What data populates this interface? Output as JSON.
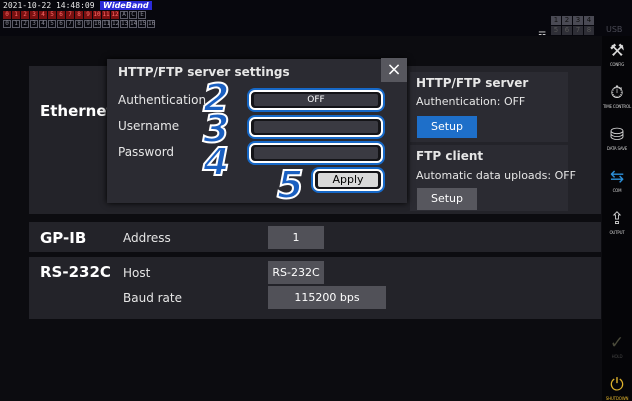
{
  "status_bar": {
    "timestamp": "2021-10-22 14:48:09",
    "mode": "WideBand",
    "channel_row1_active": [
      "0",
      "1",
      "2",
      "3",
      "4",
      "5",
      "6",
      "7",
      "8",
      "9",
      "10",
      "11",
      "12"
    ],
    "channel_row1_extra": [
      "A",
      "C",
      "E"
    ],
    "channel_row2": [
      "0",
      "1",
      "2",
      "3",
      "4",
      "5",
      "6",
      "7",
      "8",
      "9",
      "10",
      "11",
      "12",
      "13",
      "14",
      "15",
      "16"
    ],
    "ch_row1": [
      "1",
      "2",
      "3",
      "4"
    ],
    "ch_row2": [
      "5",
      "6",
      "7",
      "8"
    ],
    "usb": "USB"
  },
  "sidebar": {
    "items": [
      {
        "icon": "wrench-screwdriver-icon",
        "glyph": "⚒",
        "label": "CONFIG"
      },
      {
        "icon": "stopwatch-icon",
        "glyph": "⏱",
        "label": "TIME CONTROL"
      },
      {
        "icon": "data-save-icon",
        "glyph": "⛁",
        "label": "DATA SAVE"
      },
      {
        "icon": "com-arrows-icon",
        "glyph": "⇆",
        "label": "COM"
      },
      {
        "icon": "output-icon",
        "glyph": "⇪",
        "label": "OUTPUT"
      },
      {
        "icon": "hold-icon",
        "glyph": "✓",
        "label": "HOLD"
      },
      {
        "icon": "shutdown-icon",
        "glyph": "⏻",
        "label": "SHUTDOWN"
      }
    ]
  },
  "ethernet": {
    "label": "Ethernet"
  },
  "modal": {
    "title": "HTTP/FTP server settings",
    "close": "×",
    "authentication_label": "Authentication",
    "authentication_value": "OFF",
    "username_label": "Username",
    "username_value": "",
    "password_label": "Password",
    "password_value": "",
    "apply_label": "Apply",
    "callouts": [
      "2",
      "3",
      "4",
      "5"
    ]
  },
  "http_ftp_server": {
    "title": "HTTP/FTP server",
    "status": "Authentication: OFF",
    "button": "Setup"
  },
  "ftp_client": {
    "title": "FTP client",
    "status": "Automatic data uploads: OFF",
    "button": "Setup"
  },
  "gpib": {
    "label": "GP-IB",
    "address_label": "Address",
    "address_value": "1"
  },
  "rs232c": {
    "label": "RS-232C",
    "host_label": "Host",
    "host_value": "RS-232C",
    "baud_label": "Baud rate",
    "baud_value": "115200 bps"
  },
  "colors": {
    "accent": "#1e6fc9",
    "panel": "#232329",
    "callout": "#1a5fc0",
    "shutdown": "#e0b32c"
  }
}
